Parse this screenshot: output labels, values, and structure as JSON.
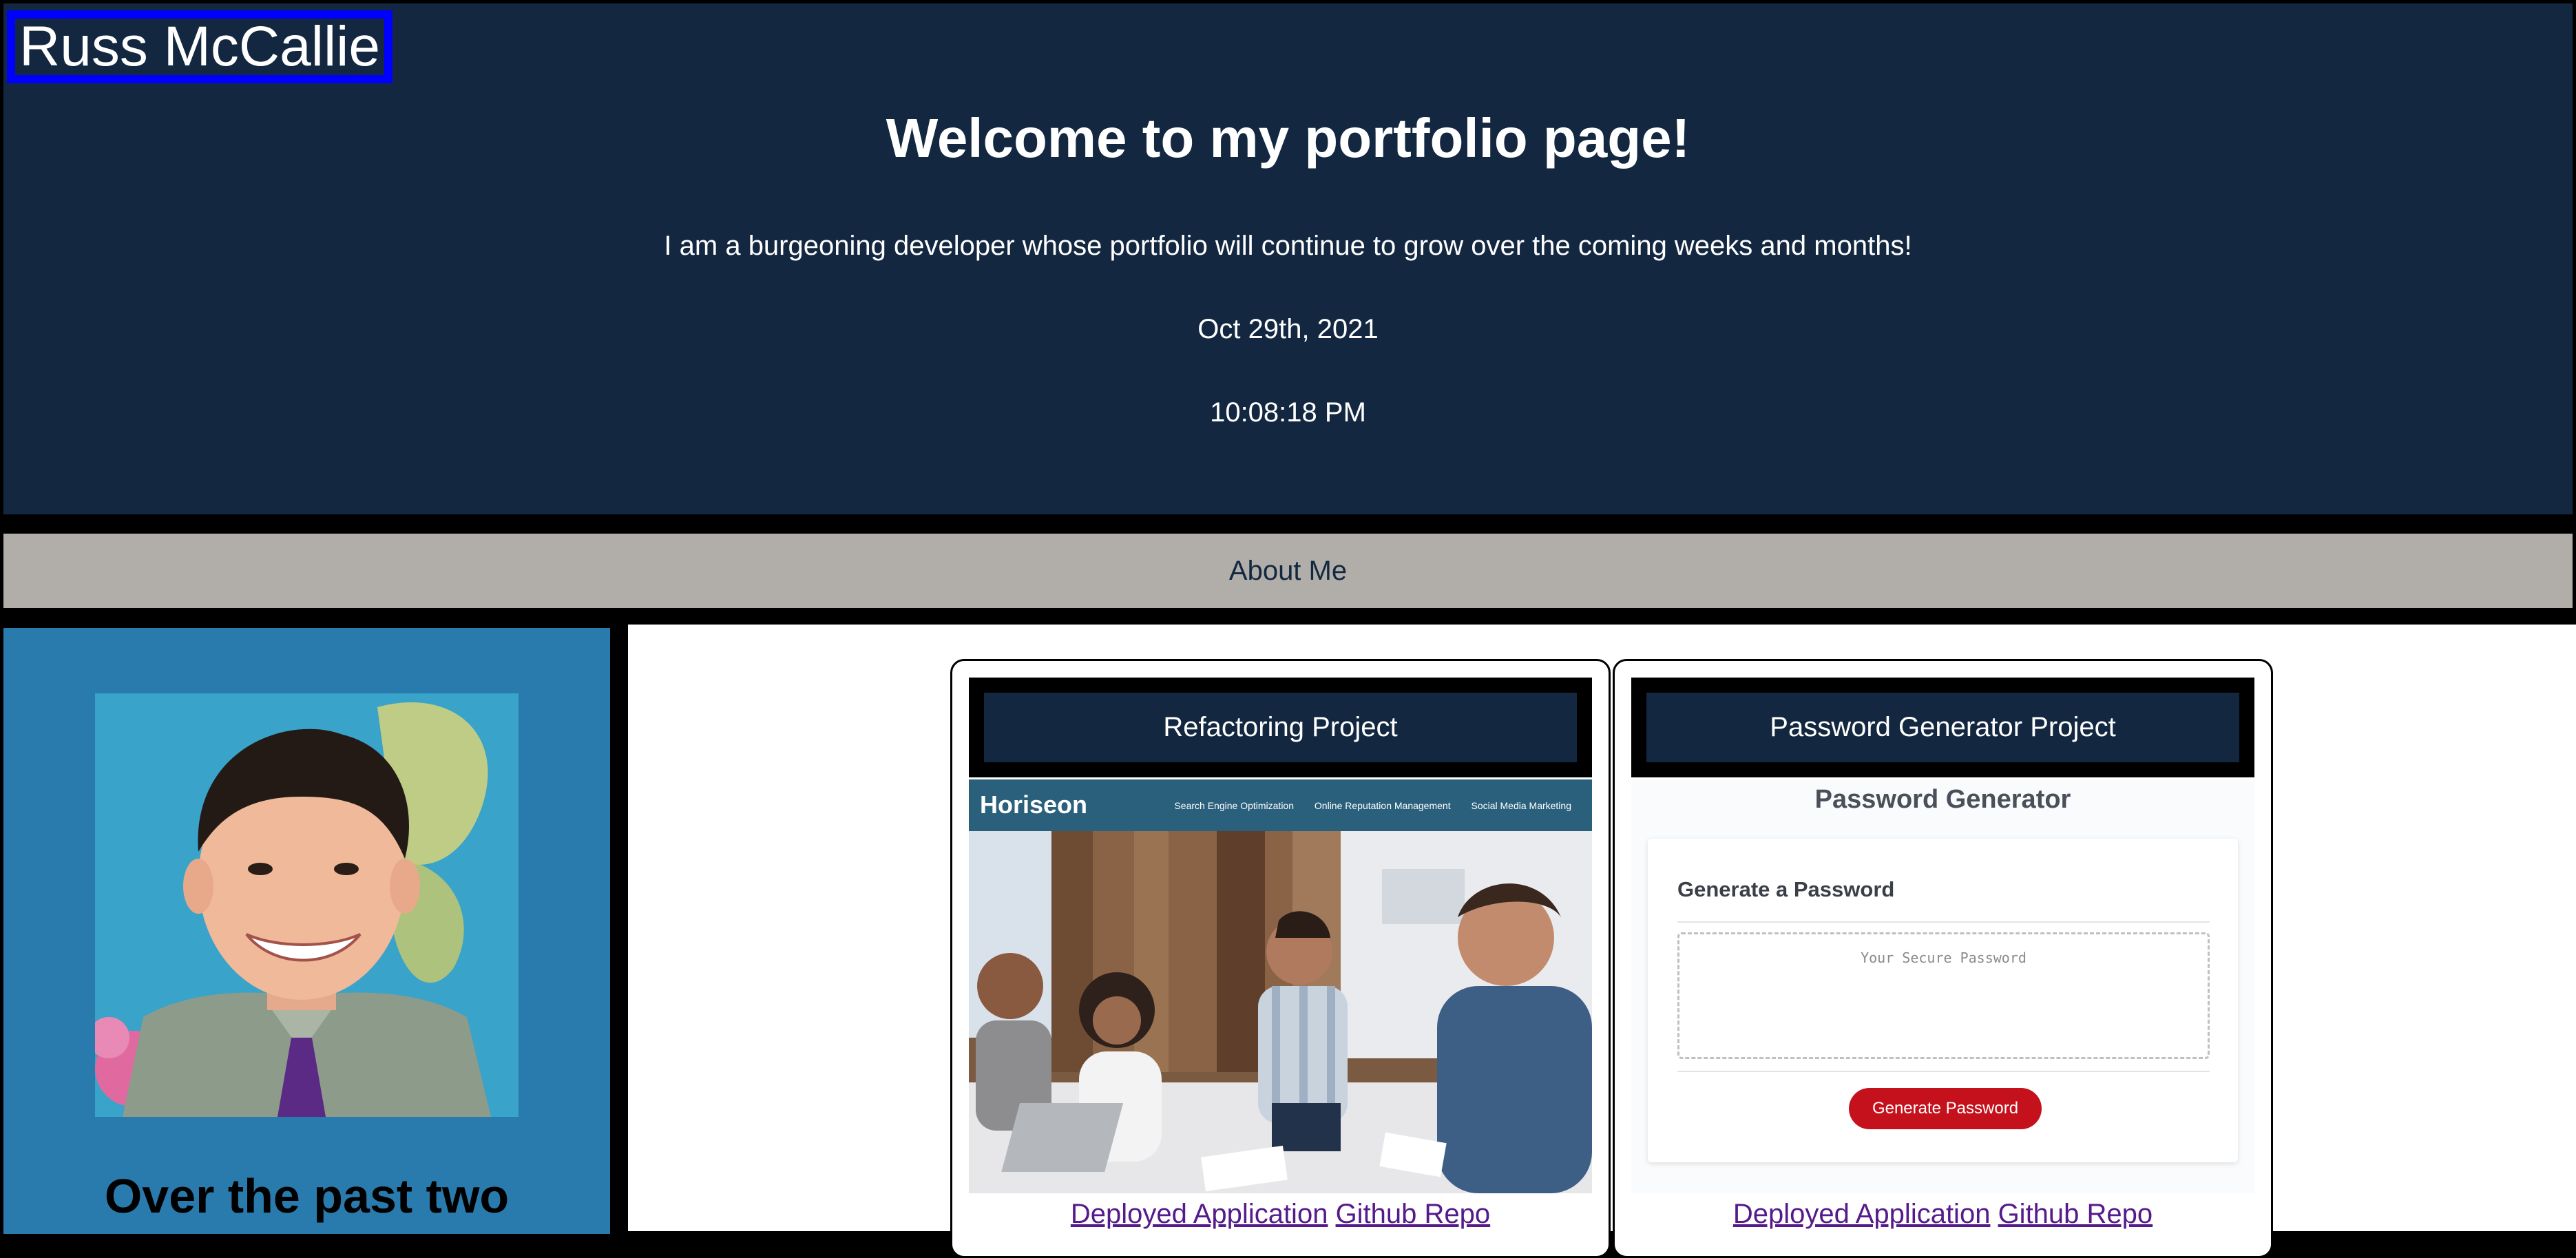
{
  "header": {
    "site_name": "Russ McCallie",
    "welcome_title": "Welcome to my portfolio page!",
    "tagline": "I am a burgeoning developer whose portfolio will continue to grow over the coming weeks and months!",
    "date": "Oct 29th, 2021",
    "time": "10:08:18 PM"
  },
  "nav": {
    "about_label": "About Me"
  },
  "sidebar": {
    "heading": "Over the past two"
  },
  "projects": [
    {
      "title": "Refactoring Project",
      "screenshot": {
        "logo": "Horiseon",
        "nav_items": [
          "Search Engine Optimization",
          "Online Reputation Management",
          "Social Media Marketing"
        ]
      },
      "links": {
        "deployed": "Deployed Application",
        "repo": "Github Repo"
      }
    },
    {
      "title": "Password Generator Project",
      "screenshot": {
        "app_title": "Password Generator",
        "panel_heading": "Generate a Password",
        "output_placeholder": "Your Secure Password",
        "button_label": "Generate Password"
      },
      "links": {
        "deployed": "Deployed Application",
        "repo": "Github Repo"
      }
    }
  ],
  "colors": {
    "header_bg": "#132840",
    "name_border": "#0000ff",
    "nav_bg": "#b1aeaa",
    "sidebar_bg": "#2a7bad",
    "link": "#551a8b",
    "generate_button": "#c4111b"
  }
}
